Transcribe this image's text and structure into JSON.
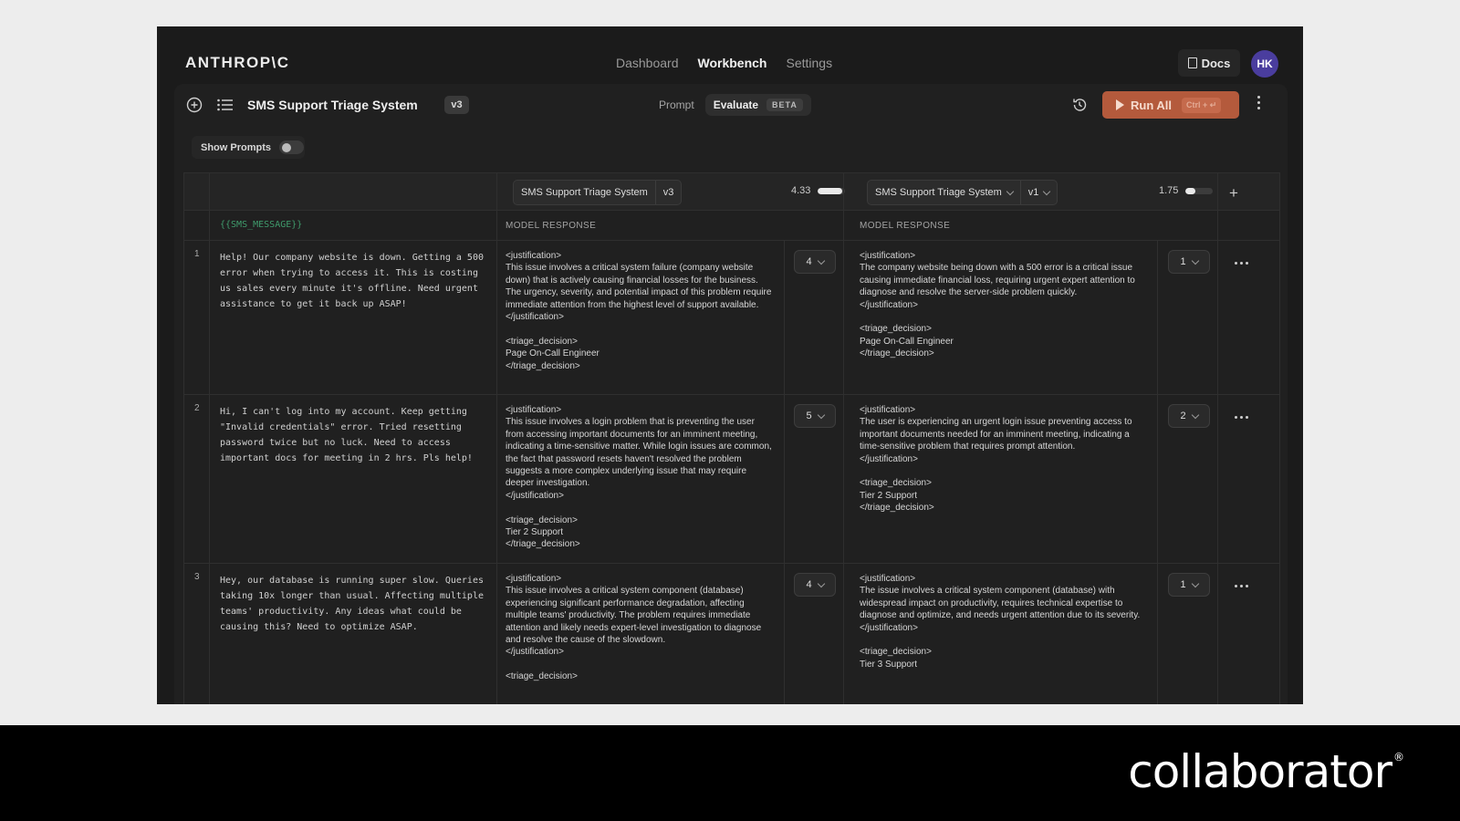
{
  "app": {
    "brand": "ANTHROP\\C",
    "nav": [
      "Dashboard",
      "Workbench",
      "Settings"
    ],
    "docs": "Docs",
    "avatar": "HK"
  },
  "toolbar": {
    "project_title": "SMS Support Triage System",
    "version": "v3",
    "tab_prompt": "Prompt",
    "tab_evaluate": "Evaluate",
    "beta": "BETA",
    "run_all": "Run All",
    "shortcut": "Ctrl + ↵",
    "show_prompts": "Show Prompts"
  },
  "columns": {
    "variable": "{{SMS_MESSAGE}}",
    "left": {
      "prompt": "SMS Support Triage System",
      "version": "v3",
      "score": "4.33",
      "score_fraction": 0.87,
      "label": "MODEL RESPONSE"
    },
    "right": {
      "prompt": "SMS Support Triage System",
      "version": "v1",
      "score": "1.75",
      "score_fraction": 0.35,
      "label": "MODEL RESPONSE"
    }
  },
  "rows": [
    {
      "num": "1",
      "message": "Help! Our company website is down. Getting a 500 error when trying to access it. This is costing us sales every minute it's offline. Need urgent assistance to get it back up ASAP!",
      "left_response": "<justification>\nThis issue involves a critical system failure (company website down) that is actively causing financial losses for the business. The urgency, severity, and potential impact of this problem require immediate attention from the highest level of support available.\n</justification>\n\n<triage_decision>\nPage On-Call Engineer\n</triage_decision>",
      "left_score": "4",
      "right_response": "<justification>\nThe company website being down with a 500 error is a critical issue causing immediate financial loss, requiring urgent expert attention to diagnose and resolve the server-side problem quickly.\n</justification>\n\n<triage_decision>\nPage On-Call Engineer\n</triage_decision>",
      "right_score": "1"
    },
    {
      "num": "2",
      "message": "Hi, I can't log into my account. Keep getting \"Invalid credentials\" error. Tried resetting password twice but no luck. Need to access important docs for meeting in 2 hrs. Pls help!",
      "left_response": "<justification>\nThis issue involves a login problem that is preventing the user from accessing important documents for an imminent meeting, indicating a time-sensitive matter. While login issues are common, the fact that password resets haven't resolved the problem suggests a more complex underlying issue that may require deeper investigation.\n</justification>\n\n<triage_decision>\nTier 2 Support\n</triage_decision>",
      "left_score": "5",
      "right_response": "<justification>\nThe user is experiencing an urgent login issue preventing access to important documents needed for an imminent meeting, indicating a time-sensitive problem that requires prompt attention.\n</justification>\n\n<triage_decision>\nTier 2 Support\n</triage_decision>",
      "right_score": "2"
    },
    {
      "num": "3",
      "message": "Hey, our database is running super slow. Queries taking 10x longer than usual. Affecting multiple teams' productivity. Any ideas what could be causing this? Need to optimize ASAP.",
      "left_response": "<justification>\nThis issue involves a critical system component (database) experiencing significant performance degradation, affecting multiple teams' productivity. The problem requires immediate attention and likely needs expert-level investigation to diagnose and resolve the cause of the slowdown.\n</justification>\n\n<triage_decision>",
      "left_score": "4",
      "right_response": "<justification>\nThe issue involves a critical system component (database) with widespread impact on productivity, requires technical expertise to diagnose and optimize, and needs urgent attention due to its severity.\n</justification>\n\n<triage_decision>\nTier 3 Support",
      "right_score": "1"
    }
  ],
  "footer": {
    "logo": "collaborator",
    "reg": "®"
  },
  "colors": {
    "accent": "#b45a3c",
    "variable": "#3f9a6b",
    "avatar": "#4a3d9e"
  }
}
